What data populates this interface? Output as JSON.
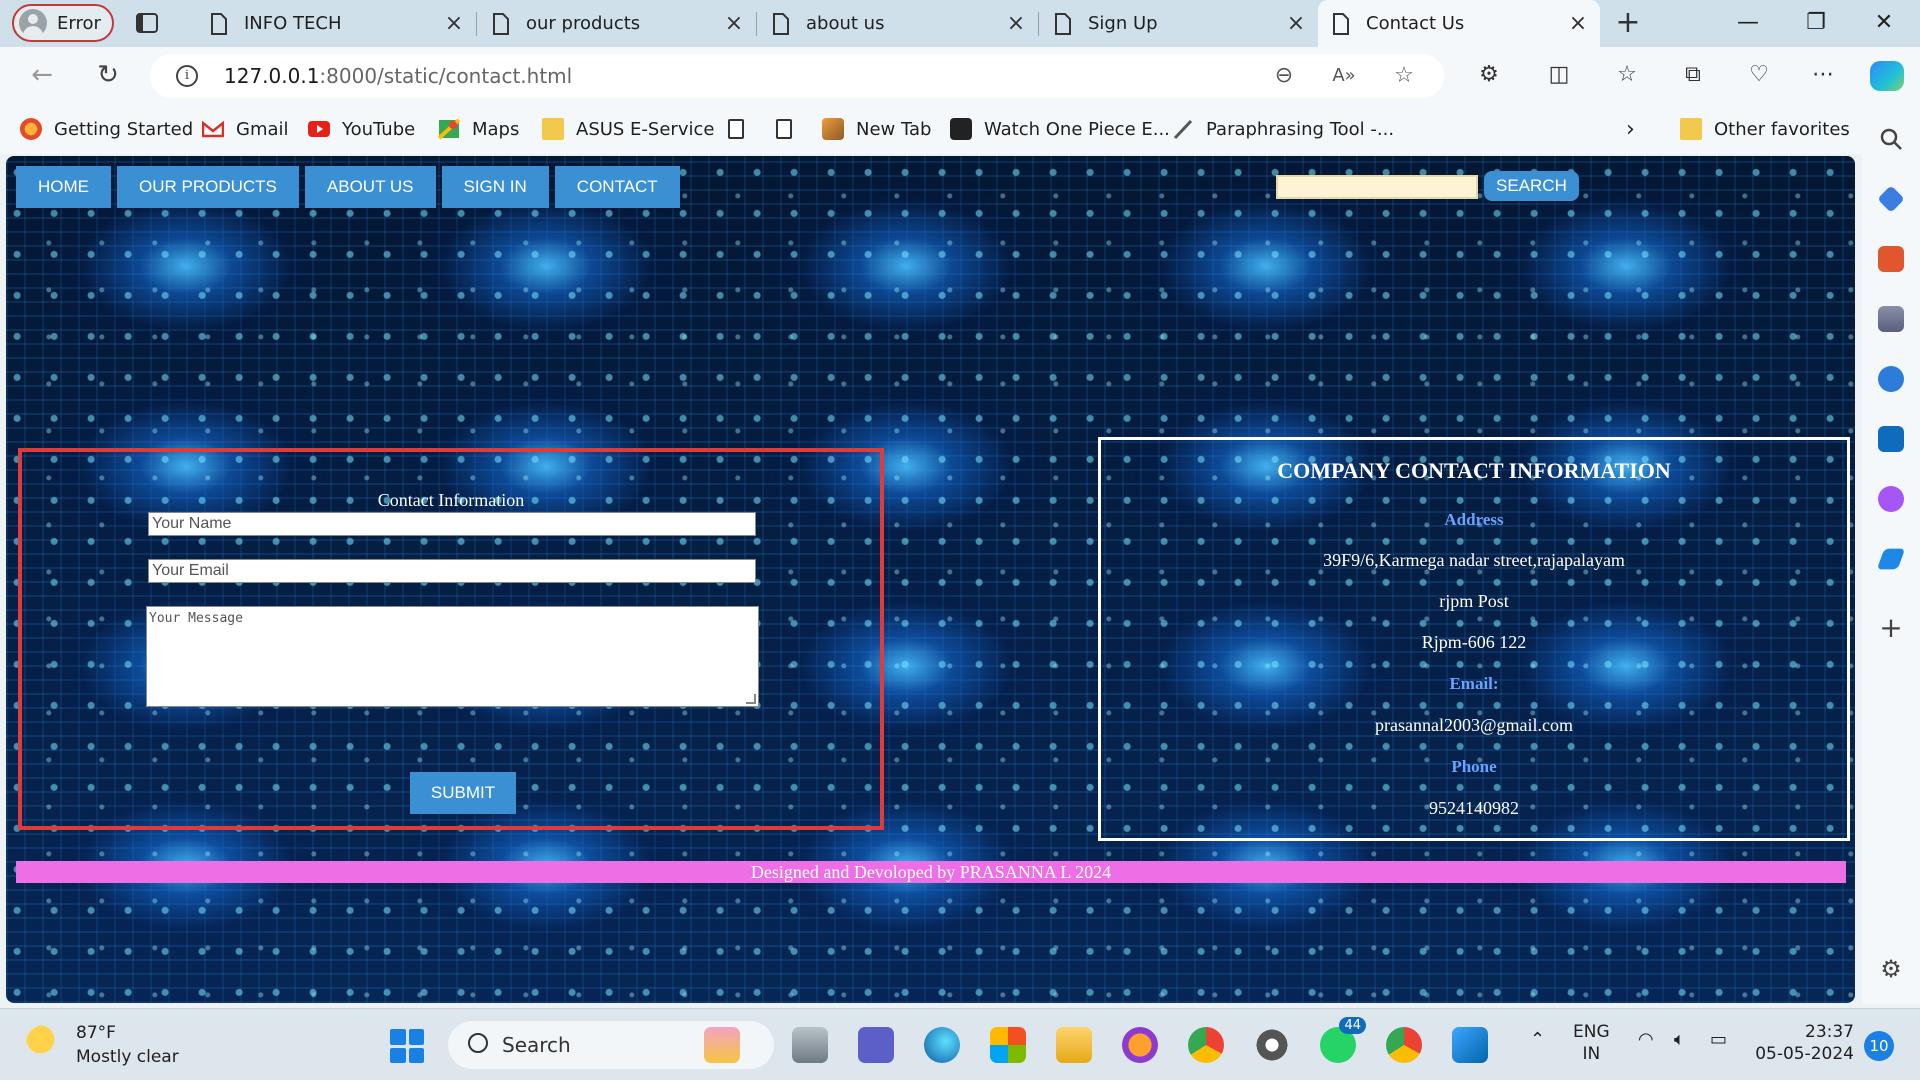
{
  "browser": {
    "profile_label": "Error",
    "tabs": [
      {
        "title": "INFO TECH"
      },
      {
        "title": "our products"
      },
      {
        "title": "about us"
      },
      {
        "title": "Sign Up"
      },
      {
        "title": "Contact Us"
      }
    ],
    "address": {
      "host": "127.0.0.1",
      "rest": ":8000/static/contact.html"
    },
    "favorites": [
      {
        "label": "Getting Started",
        "icon": "firefox-icon"
      },
      {
        "label": "Gmail",
        "icon": "gmail-icon"
      },
      {
        "label": "YouTube",
        "icon": "youtube-icon"
      },
      {
        "label": "Maps",
        "icon": "maps-icon"
      },
      {
        "label": "ASUS E-Service",
        "icon": "folder-icon"
      },
      {
        "label": "New Tab",
        "icon": "newtab-icon"
      },
      {
        "label": "Watch One Piece E...",
        "icon": "onepiece-icon"
      },
      {
        "label": "Paraphrasing Tool -...",
        "icon": "quill-icon"
      },
      {
        "label": "Other favorites",
        "icon": "folder-icon"
      }
    ]
  },
  "page": {
    "nav": [
      {
        "label": "HOME"
      },
      {
        "label": "OUR PRODUCTS"
      },
      {
        "label": "ABOUT US"
      },
      {
        "label": "SIGN IN"
      },
      {
        "label": "CONTACT"
      }
    ],
    "search_button": "SEARCH",
    "search_value": "",
    "form": {
      "heading": "Contact Information",
      "name_placeholder": "Your Name",
      "email_placeholder": "Your Email",
      "message_placeholder": "Your Message",
      "submit": "SUBMIT"
    },
    "contact": {
      "heading": "COMPANY CONTACT INFORMATION",
      "address_label": "Address",
      "address_lines": [
        "39F9/6,Karmega nadar street,rajapalayam",
        "rjpm Post",
        "Rjpm-606 122"
      ],
      "email_label": "Email:",
      "email": "prasannal2003@gmail.com",
      "phone_label": "Phone",
      "phone": "9524140982"
    },
    "footer": "Designed and Devoloped by PRASANNA L 2024"
  },
  "taskbar": {
    "temperature": "87°F",
    "weather": "Mostly clear",
    "search_label": "Search",
    "whatsapp_badge": "44",
    "language": "ENG",
    "region": "IN",
    "time": "23:37",
    "date": "05-05-2024",
    "notifications": "10"
  },
  "colors": {
    "nav_button": "#3b8fd3",
    "form_border": "#e03a3a",
    "footer_bar": "#ee6ee5",
    "label_blue": "#6aa2ff"
  }
}
